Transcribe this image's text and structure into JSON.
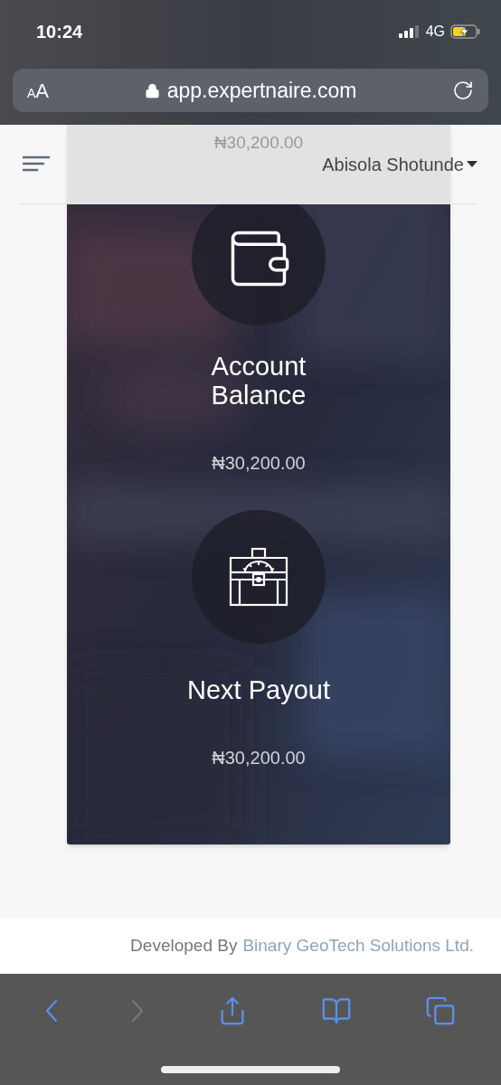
{
  "status_bar": {
    "time": "10:24",
    "network": "4G",
    "charging": true
  },
  "address_bar": {
    "text_size_button": "AA",
    "url": "app.expertnaire.com"
  },
  "header": {
    "user_name": "Abisola Shotunde",
    "faded_amount": "₦30,200.00"
  },
  "cards": [
    {
      "kind": "wallet",
      "label": "Account Balance",
      "amount": "₦30,200.00"
    },
    {
      "kind": "chest",
      "label": "Next Payout",
      "amount": "₦30,200.00"
    }
  ],
  "footer": {
    "prefix": "Developed By",
    "link": "Binary GeoTech Solutions Ltd."
  },
  "toolbar": [
    {
      "kind": "back",
      "disabled": false
    },
    {
      "kind": "forward",
      "disabled": true
    },
    {
      "kind": "share",
      "disabled": false
    },
    {
      "kind": "bookmarks",
      "disabled": false
    },
    {
      "kind": "tabs",
      "disabled": false
    }
  ]
}
